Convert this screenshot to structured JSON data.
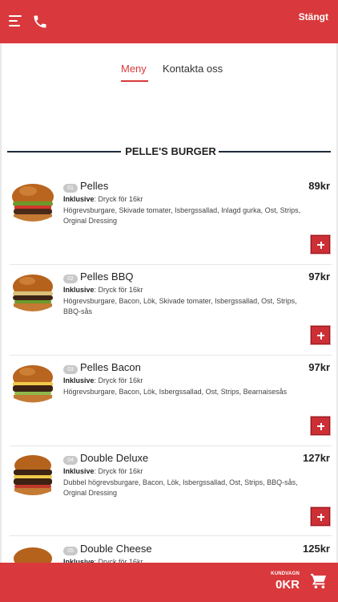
{
  "header": {
    "status": "Stängt",
    "menu_icon": "menu-icon",
    "phone_icon": "phone-icon"
  },
  "tabs": [
    {
      "label": "Meny",
      "active": true
    },
    {
      "label": "Kontakta oss",
      "active": false
    }
  ],
  "section": {
    "title": "PELLE'S BURGER"
  },
  "items": [
    {
      "num": "01",
      "name": "Pelles",
      "price": "89kr",
      "inclusive_label": "Inklusive",
      "inclusive_text": ": Dryck för 16kr",
      "desc": "Högrevsburgare, Skivade tomater, Isbergssallad, Inlagd gurka, Ost, Strips, Orginal Dressing"
    },
    {
      "num": "02",
      "name": "Pelles BBQ",
      "price": "97kr",
      "inclusive_label": "Inklusive",
      "inclusive_text": ": Dryck för 16kr",
      "desc": "Högrevsburgare, Bacon, Lök, Skivade tomater, Isbergssallad, Ost, Strips, BBQ-sås"
    },
    {
      "num": "03",
      "name": "Pelles Bacon",
      "price": "97kr",
      "inclusive_label": "Inklusive",
      "inclusive_text": ": Dryck för 16kr",
      "desc": "Högrevsburgare, Bacon, Lök, Isbergssallad, Ost, Strips, Bearnaisesås"
    },
    {
      "num": "04",
      "name": "Double Deluxe",
      "price": "127kr",
      "inclusive_label": "Inklusive",
      "inclusive_text": ": Dryck för 16kr",
      "desc": "Dubbel högrevsburgare, Bacon, Lök, Isbergssallad, Ost, Strips, BBQ-sås, Orginal Dressing"
    },
    {
      "num": "05",
      "name": "Double Cheese",
      "price": "125kr",
      "inclusive_label": "Inklusive",
      "inclusive_text": ": Dryck för 16kr",
      "desc": ""
    }
  ],
  "footer": {
    "cart_label": "KUNDVAGN",
    "cart_total": "0KR",
    "cart_icon": "cart-icon"
  },
  "colors": {
    "brand": "#d9393c",
    "add_button": "#cc2f35"
  }
}
